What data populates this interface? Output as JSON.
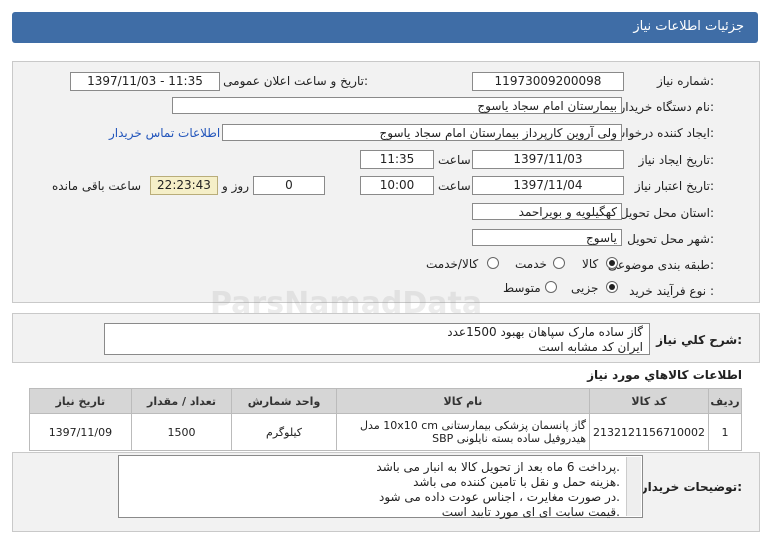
{
  "header": {
    "title": "جزئیات اطلاعات نیاز"
  },
  "form": {
    "need_number": {
      "label": "شماره نیاز:",
      "value": "11973009200098"
    },
    "announce": {
      "label": "تاریخ و ساعت اعلان عمومی:",
      "value": "1397/11/03 - 11:35"
    },
    "buyer": {
      "label": "نام دستگاه خریدار:",
      "value": "بیمارستان امام سجاد یاسوج"
    },
    "requester": {
      "label": "ایجاد کننده درخواست:",
      "value": "ولی آروین کارپرداز بیمارستان امام سجاد یاسوج",
      "contact_link": "اطلاعات تماس خریدار"
    },
    "created": {
      "label": "تاریخ ایجاد نیاز:",
      "date": "1397/11/03",
      "time_label": "ساعت",
      "time": "11:35"
    },
    "validity": {
      "label": "تاریخ اعتبار نیاز:",
      "date": "1397/11/04",
      "time_label": "ساعت",
      "time": "10:00",
      "days": "0",
      "days_label": "روز و",
      "remaining": "22:23:43",
      "remaining_label": "ساعت باقی مانده"
    },
    "province": {
      "label": "استان محل تحویل:",
      "value": "کهگیلویه و بویراحمد"
    },
    "city": {
      "label": "شهر محل تحویل:",
      "value": "یاسوج"
    },
    "category": {
      "label": "طبقه بندی موضوعی:",
      "options": [
        "کالا",
        "خدمت",
        "کالا/خدمت"
      ],
      "selected": "کالا"
    },
    "process": {
      "label": "نوع فرآیند خرید :",
      "options": [
        "جزیی",
        "متوسط"
      ],
      "selected": "جزیی"
    }
  },
  "summary": {
    "label": "شرح کلي نياز:",
    "lines": [
      "گاز ساده مارک سپاهان بهبود 1500عدد",
      "ایران کد مشابه است"
    ]
  },
  "items_section": {
    "title": "اطلاعات کالاهاي مورد نياز",
    "columns": [
      "ردیف",
      "کد کالا",
      "نام کالا",
      "واحد شمارش",
      "تعداد / مقدار",
      "تاریخ نیاز"
    ],
    "rows": [
      {
        "row": "1",
        "code": "2132121156710002",
        "name": "گاز پانسمان پزشکی بیمارستانی 10x10 cm مدل هیدروفیل ساده بسته نایلونی SBP",
        "unit": "کیلوگرم",
        "qty": "1500",
        "date": "1397/11/09"
      }
    ]
  },
  "buyer_notes": {
    "label": "توضیحات خریدار:",
    "lines": [
      "پرداخت 6 ماه بعد از تحویل کالا به انبار می باشد.",
      "هزینه حمل و نقل با تامین کننده می باشد.",
      "در صورت مغایرت ، اجناس عودت داده می شود.",
      "قیمت سایت ای ای مورد تایید است."
    ]
  },
  "watermark": {
    "text": "ParsNamadData"
  }
}
